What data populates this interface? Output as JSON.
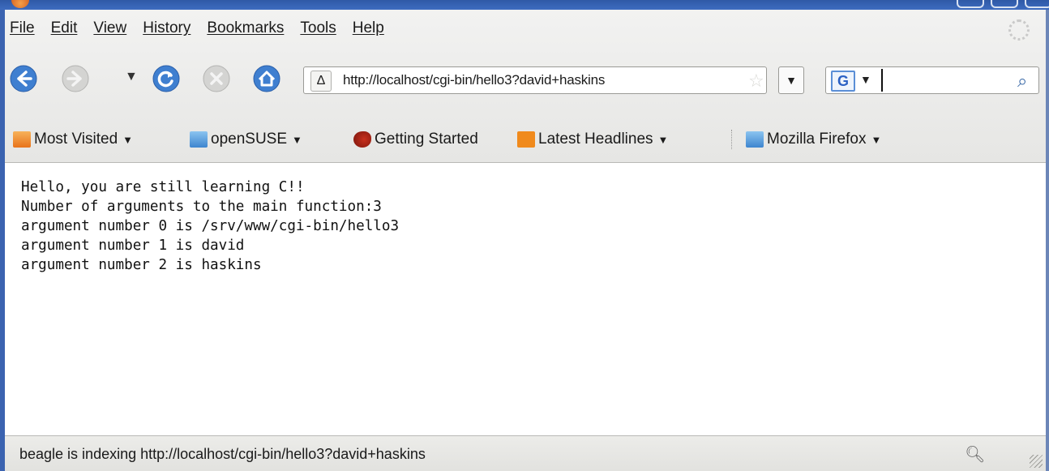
{
  "menubar": {
    "items": [
      "File",
      "Edit",
      "View",
      "History",
      "Bookmarks",
      "Tools",
      "Help"
    ]
  },
  "navbar": {
    "url": "http://localhost/cgi-bin/hello3?david+haskins",
    "search_engine_letter": "G",
    "search_value": ""
  },
  "bookmarks": {
    "items": [
      {
        "label": "Most Visited",
        "dropdown": true
      },
      {
        "label": "openSUSE",
        "dropdown": true
      },
      {
        "label": "Getting Started",
        "dropdown": false
      },
      {
        "label": "Latest Headlines",
        "dropdown": true
      },
      {
        "label": "Mozilla Firefox",
        "dropdown": true
      }
    ]
  },
  "content": {
    "lines": [
      "Hello, you are still learning C!!",
      "Number of arguments to the main function:3",
      "argument number 0 is /srv/www/cgi-bin/hello3",
      "argument number 1 is david",
      "argument number 2 is haskins"
    ]
  },
  "status": {
    "text": "beagle is indexing http://localhost/cgi-bin/hello3?david+haskins"
  },
  "colors": {
    "titlebar": "#3b63b0",
    "nav_blue": "#3f7fd0",
    "nav_gray": "#c8c8c8",
    "folder": "#5aa0e0",
    "rss": "#f08a1c"
  }
}
